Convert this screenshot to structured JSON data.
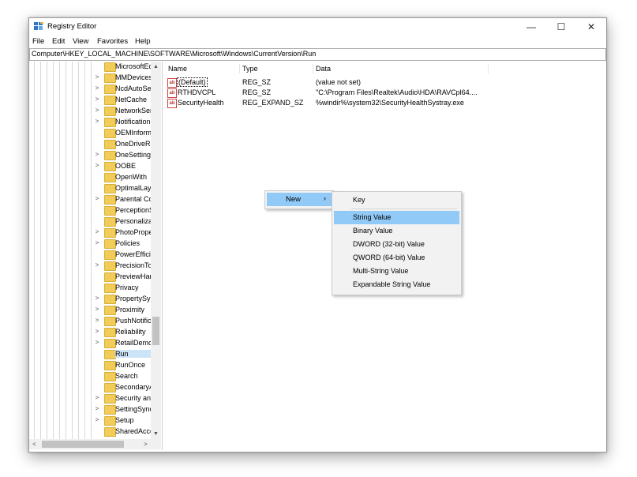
{
  "window": {
    "title": "Registry Editor",
    "controls": {
      "minimize": "—",
      "maximize": "☐",
      "close": "✕"
    }
  },
  "menubar": [
    "File",
    "Edit",
    "View",
    "Favorites",
    "Help"
  ],
  "address": "Computer\\HKEY_LOCAL_MACHINE\\SOFTWARE\\Microsoft\\Windows\\CurrentVersion\\Run",
  "tree": {
    "items": [
      {
        "label": "MicrosoftEdge",
        "expandable": false
      },
      {
        "label": "MMDevices",
        "expandable": true
      },
      {
        "label": "NcdAutoSetup",
        "expandable": true
      },
      {
        "label": "NetCache",
        "expandable": true
      },
      {
        "label": "NetworkServiceTriggers",
        "expandable": true
      },
      {
        "label": "Notifications",
        "expandable": true
      },
      {
        "label": "OEMInformation",
        "expandable": false
      },
      {
        "label": "OneDriveRamps",
        "expandable": false
      },
      {
        "label": "OneSettings",
        "expandable": true
      },
      {
        "label": "OOBE",
        "expandable": true
      },
      {
        "label": "OpenWith",
        "expandable": false
      },
      {
        "label": "OptimalLayout",
        "expandable": false
      },
      {
        "label": "Parental Controls",
        "expandable": true
      },
      {
        "label": "PerceptionSimulation",
        "expandable": false
      },
      {
        "label": "Personalization",
        "expandable": false
      },
      {
        "label": "PhotoPropertyHandler",
        "expandable": true
      },
      {
        "label": "Policies",
        "expandable": true
      },
      {
        "label": "PowerEfficiency",
        "expandable": false
      },
      {
        "label": "PrecisionTouchPad",
        "expandable": true
      },
      {
        "label": "PreviewHandlers",
        "expandable": false
      },
      {
        "label": "Privacy",
        "expandable": false
      },
      {
        "label": "PropertySystem",
        "expandable": true
      },
      {
        "label": "Proximity",
        "expandable": true
      },
      {
        "label": "PushNotifications",
        "expandable": true
      },
      {
        "label": "Reliability",
        "expandable": true
      },
      {
        "label": "RetailDemo",
        "expandable": true
      },
      {
        "label": "Run",
        "expandable": false,
        "selected": true
      },
      {
        "label": "RunOnce",
        "expandable": false
      },
      {
        "label": "Search",
        "expandable": false
      },
      {
        "label": "SecondaryAuthFactor",
        "expandable": false
      },
      {
        "label": "Security and Maintenance",
        "expandable": true
      },
      {
        "label": "SettingSync",
        "expandable": true
      },
      {
        "label": "Setup",
        "expandable": true
      },
      {
        "label": "SharedAccess",
        "expandable": false
      }
    ]
  },
  "columns": {
    "name": "Name",
    "type": "Type",
    "data": "Data"
  },
  "values": [
    {
      "name": "(Default)",
      "type": "REG_SZ",
      "data": "(value not set)"
    },
    {
      "name": "RTHDVCPL",
      "type": "REG_SZ",
      "data": "\"C:\\Program Files\\Realtek\\Audio\\HDA\\RAVCpl64...."
    },
    {
      "name": "SecurityHealth",
      "type": "REG_EXPAND_SZ",
      "data": "%windir%\\system32\\SecurityHealthSystray.exe"
    }
  ],
  "value_icon": "ab",
  "context_menu": {
    "new_label": "New",
    "arrow": "›"
  },
  "submenu": {
    "items": [
      "Key",
      "String Value",
      "Binary Value",
      "DWORD (32-bit) Value",
      "QWORD (64-bit) Value",
      "Multi-String Value",
      "Expandable String Value"
    ],
    "highlighted": "String Value"
  },
  "scroll_arrows": {
    "up": "▲",
    "down": "▼",
    "left": "<",
    "right": ">"
  }
}
